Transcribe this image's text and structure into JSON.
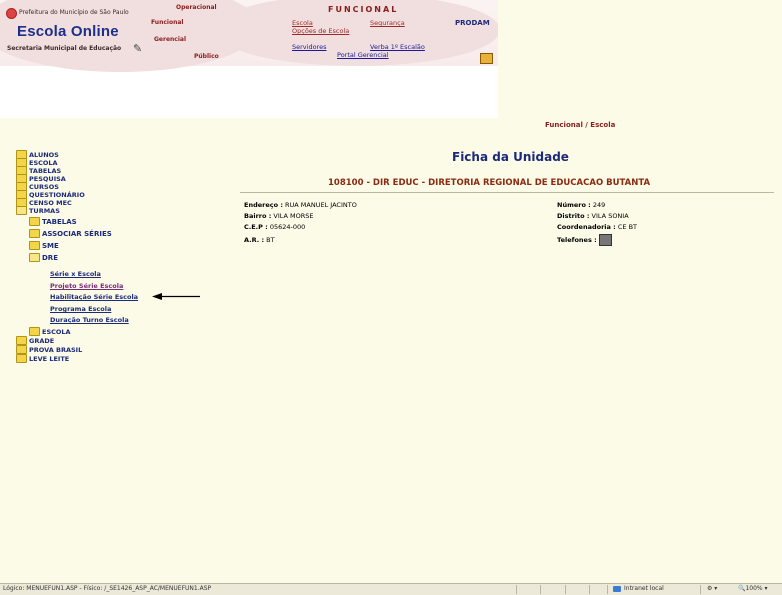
{
  "header": {
    "prefeitura": "Prefeitura do Município de São Paulo",
    "app_name": "Escola Online",
    "secretaria": "Secretaria Municipal de Educação",
    "menus": [
      "Operacional",
      "Funcional",
      "Gerencial",
      "Público"
    ],
    "section_title": "FUNCIONAL",
    "links": {
      "escola": "Escola",
      "opcoes_escola": "Opções de Escola",
      "seguranca": "Segurança",
      "prodam": "PRODAM",
      "servidores": "Servidores",
      "verba": "Verba 1º Escalão",
      "portal": "Portal Gerencial"
    }
  },
  "breadcrumb": "Funcional / Escola",
  "tree": {
    "top_items": [
      "ALUNOS",
      "ESCOLA",
      "TABELAS",
      "PESQUISA",
      "CURSOS",
      "QUESTIONÁRIO",
      "CENSO MEC",
      "TURMAS"
    ],
    "turmas_children": [
      "TABELAS",
      "ASSOCIAR SÉRIES",
      "SME",
      "DRE"
    ],
    "dre_links": [
      "Série x Escola",
      "Projeto Série Escola",
      "Habilitação Série Escola",
      "Programa Escola",
      "Duração Turno Escola"
    ],
    "after_items": [
      "ESCOLA"
    ],
    "bottom_items": [
      "GRADE",
      "PROVA BRASIL",
      "LEVE LEITE"
    ]
  },
  "main": {
    "page_title": "Ficha da Unidade",
    "unit_title": "108100 - DIR EDUC - DIRETORIA REGIONAL DE EDUCACAO BUTANTA",
    "left_fields": [
      {
        "label": "Endereço :",
        "value": "RUA MANUEL JACINTO"
      },
      {
        "label": "Bairro :",
        "value": "VILA MORSE"
      },
      {
        "label": "C.E.P :",
        "value": "05624-000"
      },
      {
        "label": "A.R. :",
        "value": "BT"
      }
    ],
    "right_fields": [
      {
        "label": "Número :",
        "value": "249"
      },
      {
        "label": "Distrito :",
        "value": "VILA SONIA"
      },
      {
        "label": "Coordenadoria :",
        "value": "CE BT"
      },
      {
        "label": "Telefones :",
        "value": ""
      }
    ]
  },
  "statusbar": {
    "path": "Lógico: MENUEFUN1.ASP - Físico: /_SE1426_ASP_AC/MENUEFUN1.ASP",
    "zone": "Intranet local",
    "zoom": "100%"
  }
}
